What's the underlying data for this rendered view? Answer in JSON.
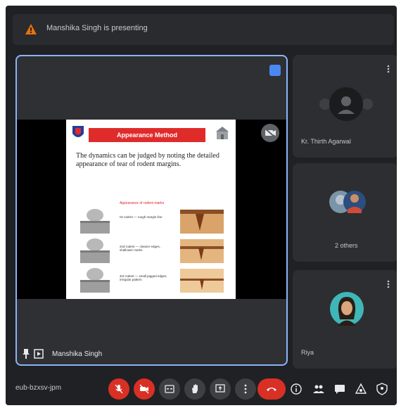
{
  "topbar": {
    "presenting_text": "Manshika Singh is presenting"
  },
  "main": {
    "presenter_name": "Manshika Singh",
    "slide": {
      "title": "Appearance Method",
      "body": "The dynamics can be judged by noting the detailed appearance of tear of rodent margins.",
      "caption": "Appearance of rodent marks",
      "rows": [
        {
          "text": "Ist rodent — rough margin line"
        },
        {
          "text": "2nd rodent — cleaner edges, shallower marks"
        },
        {
          "text": "3rd rodent — small jagged edges, irregular pattern"
        }
      ]
    }
  },
  "participants": [
    {
      "name": "Kr. Thirth Agarwal"
    },
    {
      "name": "2 others"
    },
    {
      "name": "Riya"
    }
  ],
  "bottombar": {
    "meeting_code": "eub-bzxsv-jpm"
  },
  "colors": {
    "accent": "#8ab4f8",
    "end_call": "#d93025",
    "slide_title": "#e02b2b"
  }
}
